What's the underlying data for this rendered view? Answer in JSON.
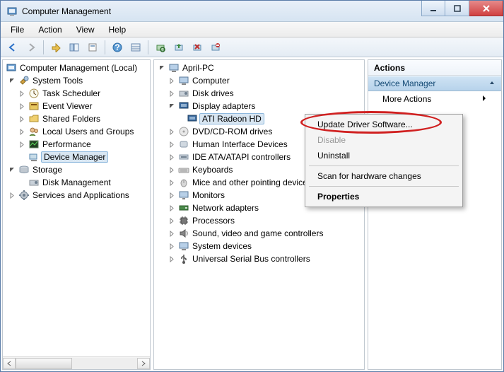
{
  "title": "Computer Management",
  "menus": {
    "file": "File",
    "action": "Action",
    "view": "View",
    "help": "Help"
  },
  "left": {
    "root": "Computer Management (Local)",
    "systools": "System Tools",
    "taskscheduler": "Task Scheduler",
    "eventviewer": "Event Viewer",
    "sharedfolders": "Shared Folders",
    "localusers": "Local Users and Groups",
    "performance": "Performance",
    "devicemanager": "Device Manager",
    "storage": "Storage",
    "diskmgmt": "Disk Management",
    "services": "Services and Applications"
  },
  "mid": {
    "root": "April-PC",
    "computer": "Computer",
    "diskdrives": "Disk drives",
    "displayadapters": "Display adapters",
    "gpu": "ATI Radeon HD",
    "dvd": "DVD/CD-ROM drives",
    "hid": "Human Interface Devices",
    "ide": "IDE ATA/ATAPI controllers",
    "keyboards": "Keyboards",
    "mice": "Mice and other pointing devices",
    "monitors": "Monitors",
    "network": "Network adapters",
    "processors": "Processors",
    "sound": "Sound, video and game controllers",
    "sysdev": "System devices",
    "usb": "Universal Serial Bus controllers"
  },
  "actions": {
    "header": "Actions",
    "section": "Device Manager",
    "more": "More Actions"
  },
  "context": {
    "update": "Update Driver Software...",
    "disable": "Disable",
    "uninstall": "Uninstall",
    "scan": "Scan for hardware changes",
    "properties": "Properties"
  }
}
